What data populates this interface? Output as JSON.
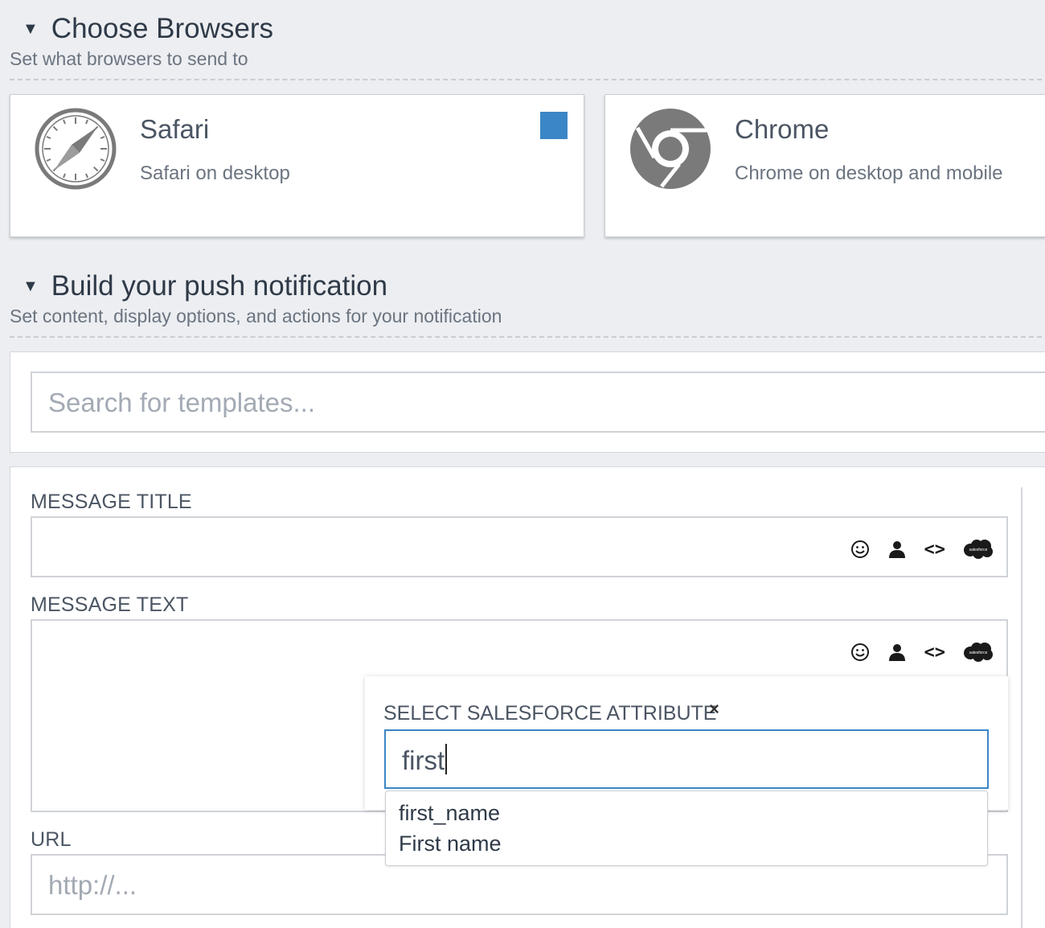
{
  "browsers_section": {
    "title": "Choose Browsers",
    "subtitle": "Set what browsers to send to"
  },
  "browsers": [
    {
      "name": "Safari",
      "description": "Safari on desktop",
      "icon": "safari-icon",
      "selected": true
    },
    {
      "name": "Chrome",
      "description": "Chrome on desktop and mobile",
      "icon": "chrome-icon",
      "selected": false
    }
  ],
  "build_section": {
    "title": "Build your push notification",
    "subtitle": "Set content, display options, and actions for your notification"
  },
  "template_search": {
    "placeholder": "Search for templates..."
  },
  "fields": {
    "message_title": {
      "label": "MESSAGE TITLE",
      "value": ""
    },
    "message_text": {
      "label": "MESSAGE TEXT",
      "value": ""
    },
    "url": {
      "label": "URL",
      "placeholder": "http://..."
    }
  },
  "toolbar_icons": [
    "emoji-icon",
    "person-icon",
    "code-icon",
    "salesforce-icon"
  ],
  "salesforce_logo_text": "salesforce",
  "attribute_popover": {
    "label": "SELECT SALESFORCE ATTRIBUTE",
    "close_glyph": "×",
    "query": "first",
    "options": [
      "first_name",
      "First name"
    ]
  },
  "colors": {
    "accent": "#3b86c6",
    "background": "#eceef1"
  }
}
